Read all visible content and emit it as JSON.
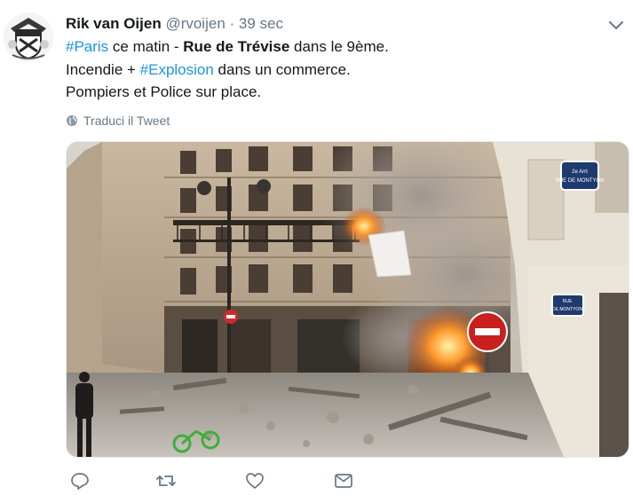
{
  "tweet": {
    "author": {
      "name": "Rik van Oijen",
      "handle": "@rvoijen",
      "separator": "·",
      "time": "39 sec"
    },
    "line1": {
      "tag1": "#Paris",
      "text1": " ce matin - ",
      "bold": "Rue de Trévise",
      "text2": " dans le 9ème."
    },
    "line2": {
      "text1": "Incendie + ",
      "tag": "#Explosion",
      "text2": " dans un commerce."
    },
    "line3": "Pompiers et Police sur place.",
    "translate_label": "Traduci il Tweet",
    "image_signs": {
      "street_sign_top": "2e Arrt RUE DE MONTYON",
      "street_sign_bottom": "RUE DE MONTYON"
    }
  },
  "icons": {
    "menu": "chevron-down-icon",
    "translate": "globe-icon",
    "reply": "reply-icon",
    "retweet": "retweet-icon",
    "like": "heart-icon",
    "message": "envelope-icon"
  },
  "colors": {
    "link": "#1b95e0",
    "text": "#14171a",
    "secondary": "#657786"
  }
}
